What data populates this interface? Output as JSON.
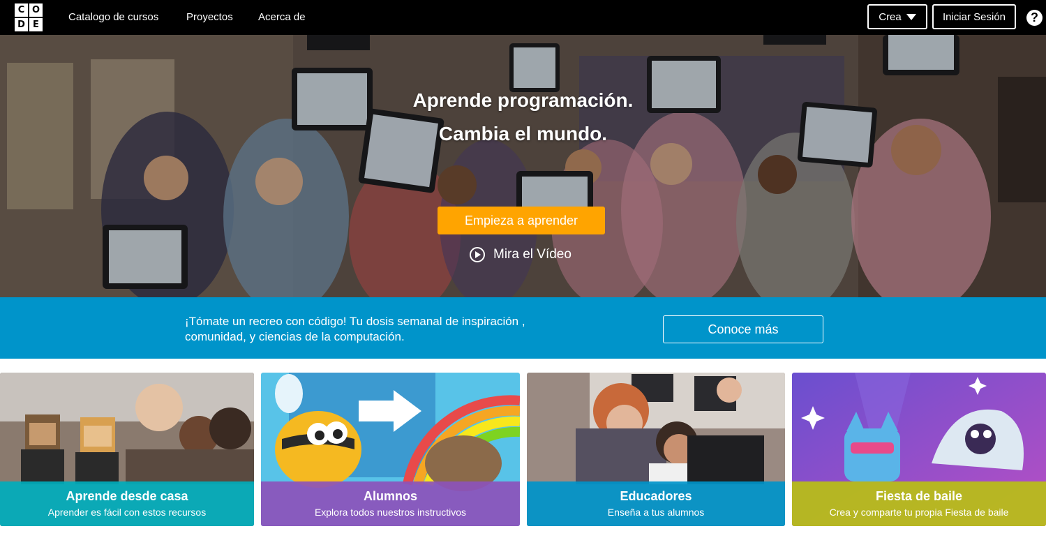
{
  "logo": {
    "letters": [
      "C",
      "O",
      "D",
      "E"
    ]
  },
  "nav": {
    "links": [
      "Catalogo de cursos",
      "Proyectos",
      "Acerca de"
    ],
    "create_label": "Crea",
    "login_label": "Iniciar Sesión",
    "help_symbol": "?"
  },
  "hero": {
    "title_line1": "Aprende programación.",
    "title_line2": "Cambia el mundo.",
    "start_button": "Empieza a aprender",
    "video_link": "Mira el Vídeo"
  },
  "banner": {
    "line1": "¡Tómate un recreo con código! Tu dosis semanal de inspiración ,",
    "line2": "comunidad, y ciencias de la computación.",
    "button": "Conoce más"
  },
  "cards": [
    {
      "title": "Aprende desde casa",
      "subtitle": "Aprender es fácil con estos recursos",
      "color": "#00adbc"
    },
    {
      "title": "Alumnos",
      "subtitle": "Explora todos nuestros instructivos",
      "color": "#8c52ba"
    },
    {
      "title": "Educadores",
      "subtitle": "Enseña a tus alumnos",
      "color": "#0094ca"
    },
    {
      "title": "Fiesta de baile",
      "subtitle": "Crea y comparte tu propia Fiesta de baile",
      "color": "#b9bf15"
    }
  ],
  "colors": {
    "nav_bg": "#000000",
    "accent_orange": "#ffa400",
    "banner_blue": "#0094ca"
  }
}
